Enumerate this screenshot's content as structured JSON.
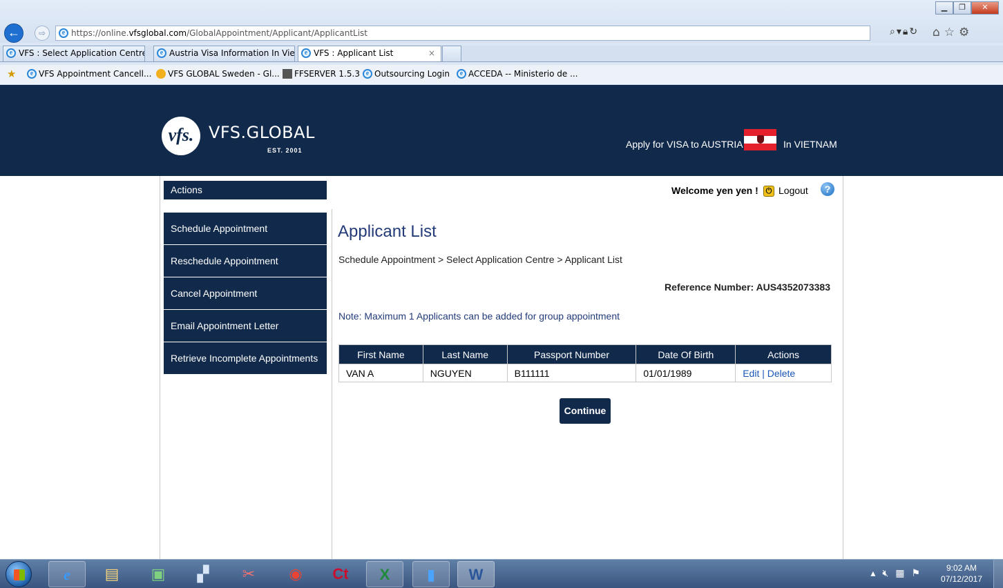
{
  "browser": {
    "url_prefix": "https://online.",
    "url_domain": "vfsglobal.com",
    "url_path": "/GlobalAppointment/Applicant/ApplicantList",
    "tabs": [
      {
        "label": "VFS : Select Application Centre"
      },
      {
        "label": "Austria Visa Information In Vie..."
      },
      {
        "label": "VFS : Applicant List",
        "close": "×"
      }
    ],
    "favorites": [
      {
        "label": "VFS Appointment Cancell..."
      },
      {
        "label": "VFS GLOBAL Sweden - Gl..."
      },
      {
        "label": "FFSERVER 1.5.3"
      },
      {
        "label": "Outsourcing Login"
      },
      {
        "label": "ACCEDA -- Ministerio de ..."
      }
    ],
    "toolbar_icons": [
      "search-icon",
      "lock-icon",
      "refresh-icon",
      "home-icon",
      "favorites-star-icon",
      "settings-gear-icon"
    ]
  },
  "header": {
    "logo_mark": "vfs.",
    "logo_name": "VFS.GLOBAL",
    "logo_est": "EST. 2001",
    "apply_text": "Apply for VISA to AUSTRIA",
    "country_text": "In VIETNAM"
  },
  "sidebar": {
    "title": "Actions",
    "items": [
      {
        "label": "Schedule Appointment"
      },
      {
        "label": "Reschedule Appointment"
      },
      {
        "label": "Cancel Appointment"
      },
      {
        "label": "Email Appointment Letter"
      },
      {
        "label": "Retrieve Incomplete Appointments"
      }
    ]
  },
  "user": {
    "welcome": "Welcome yen yen !",
    "logout": "Logout"
  },
  "main": {
    "title": "Applicant List",
    "breadcrumb": "Schedule Appointment  >  Select Application Centre  >  Applicant List",
    "reference": "Reference Number: AUS4352073383",
    "note": "Note: Maximum 1 Applicants can be added for group appointment",
    "table": {
      "headers": [
        "First Name",
        "Last Name",
        "Passport Number",
        "Date Of Birth",
        "Actions"
      ],
      "rows": [
        {
          "first": "VAN A",
          "last": "NGUYEN",
          "passport": "B111111",
          "dob": "01/01/1989",
          "edit": "Edit",
          "sep": " | ",
          "delete": "Delete"
        }
      ]
    },
    "continue": "Continue"
  },
  "taskbar": {
    "apps": [
      "internet-explorer-icon",
      "file-explorer-icon",
      "network-icon",
      "computer-icon",
      "snipping-tool-icon",
      "chrome-icon",
      "ct-app-icon",
      "excel-icon",
      "blue-app-icon",
      "word-icon"
    ],
    "time": "9:02 AM",
    "date": "07/12/2017"
  }
}
